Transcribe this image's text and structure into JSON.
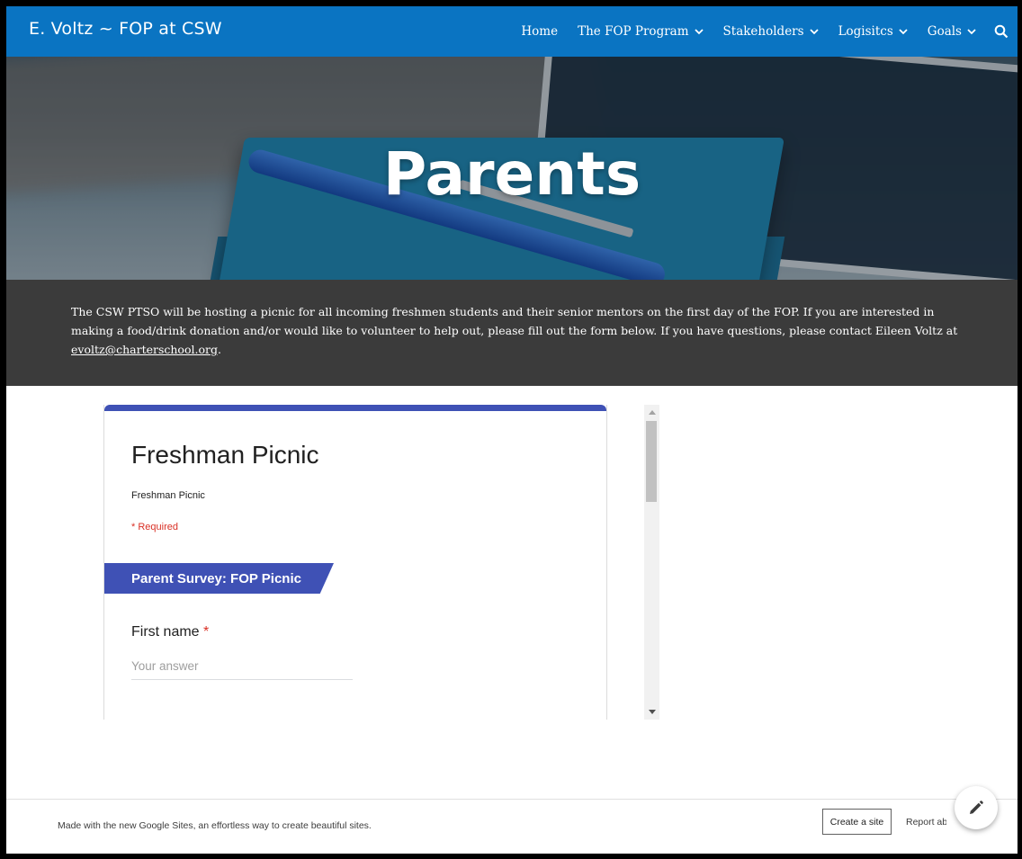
{
  "header": {
    "site_title": "E. Voltz ~ FOP at CSW",
    "nav": [
      {
        "label": "Home",
        "has_dropdown": false
      },
      {
        "label": "The FOP Program",
        "has_dropdown": true
      },
      {
        "label": "Stakeholders",
        "has_dropdown": true
      },
      {
        "label": "Logisitcs",
        "has_dropdown": true
      },
      {
        "label": "Goals",
        "has_dropdown": true
      }
    ],
    "search_icon": "search-icon"
  },
  "hero": {
    "title": "Parents"
  },
  "description": {
    "text": "The CSW PTSO will be hosting a picnic for all incoming freshmen students and their senior mentors on the first day of the FOP. If you are interested in making a food/drink donation and/or would like to volunteer to help out, please fill out the form below. If you have questions, please contact Eileen Voltz at ",
    "email": "evoltz@charterschool.org",
    "after": "."
  },
  "form": {
    "title": "Freshman Picnic",
    "description": "Freshman Picnic",
    "required_note": "* Required",
    "section_title": "Parent Survey: FOP Picnic",
    "question_label": "First name",
    "required_star": "*",
    "answer_placeholder": "Your answer"
  },
  "footer": {
    "text": "Made with the new Google Sites, an effortless way to create beautiful sites.",
    "create_label": "Create a site",
    "report_label": "Report abuse"
  },
  "colors": {
    "nav_bg": "#0a74c2",
    "band_bg": "#3b3b3b",
    "form_accent": "#3f51b5",
    "required_red": "#d93025"
  }
}
